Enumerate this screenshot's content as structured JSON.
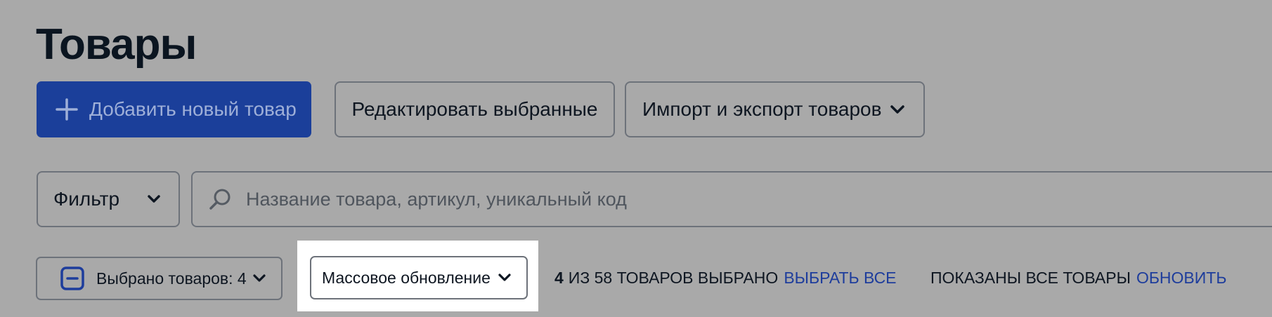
{
  "header": {
    "title": "Товары"
  },
  "toolbar": {
    "add_label": "Добавить новый товар",
    "edit_label": "Редактировать выбранные",
    "import_label": "Импорт и экспорт товаров"
  },
  "filter": {
    "label": "Фильтр"
  },
  "search": {
    "placeholder": "Название товара, артикул, уникальный код"
  },
  "selection": {
    "label": "Выбрано товаров: 4",
    "mass_update_label": "Массовое обновление",
    "count": "4",
    "summary": "ИЗ 58 ТОВАРОВ ВЫБРАНО",
    "select_all_label": "ВЫБРАТЬ ВСЕ",
    "shown_text": "ПОКАЗАНЫ ВСЕ ТОВАРЫ",
    "refresh_label": "ОБНОВИТЬ"
  },
  "colors": {
    "background": "#a9a9a9",
    "primary": "#1b3f9a",
    "link": "#1e3d9c",
    "highlight": "#ffffff"
  },
  "icons": [
    "plus-icon",
    "chevron-down-icon",
    "search-icon",
    "minus-checkbox-icon"
  ]
}
